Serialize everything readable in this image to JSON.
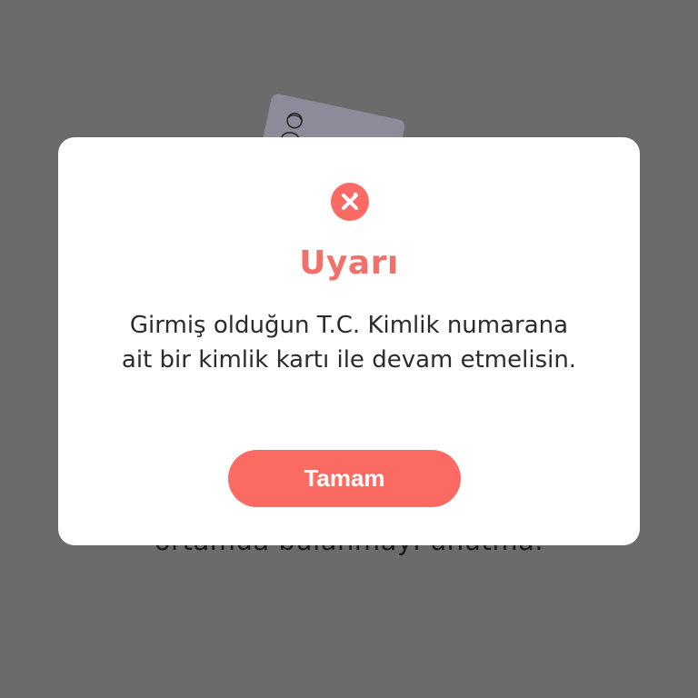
{
  "colors": {
    "overlay": "#6b6b6b",
    "accent": "#fb6b63",
    "title": "#f0716a",
    "text": "#2b2b2b",
    "dialog_bg": "#ffffff"
  },
  "background": {
    "partial_text": "ortamda bulanmayı unutma."
  },
  "dialog": {
    "icon": "warning-x-icon",
    "title": "Uyarı",
    "message": "Girmiş olduğun T.C. Kimlik numarana ait bir kimlik kartı ile devam etmelisin.",
    "ok_label": "Tamam"
  }
}
